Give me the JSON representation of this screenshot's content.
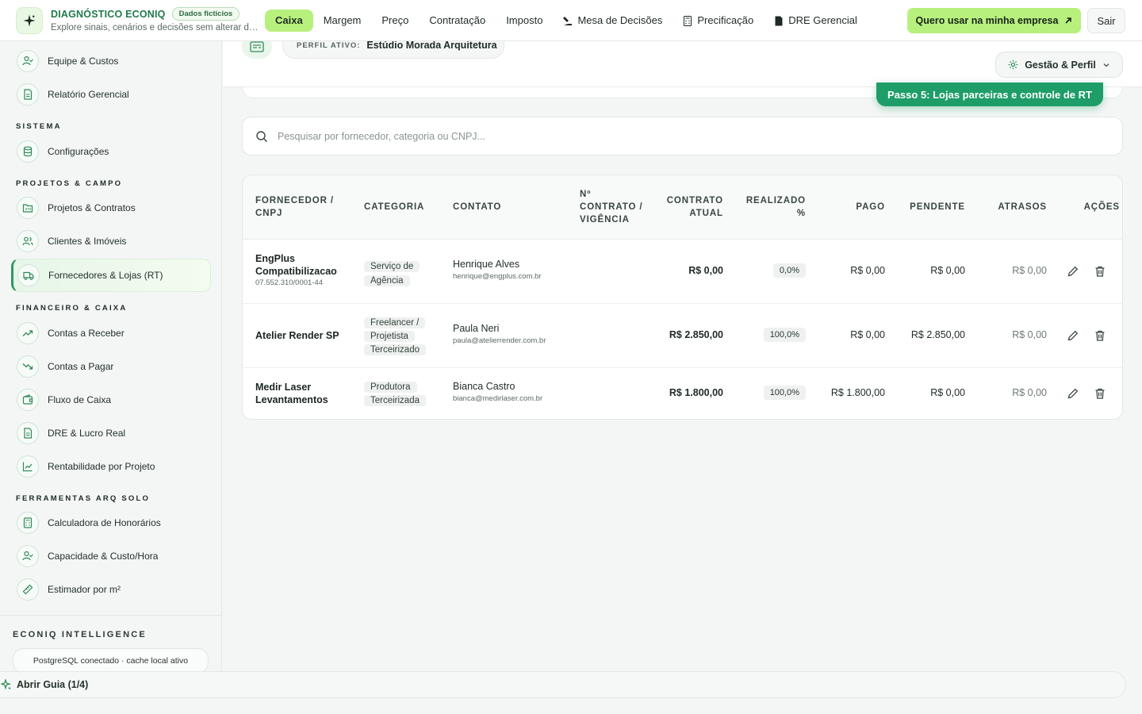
{
  "brand": {
    "title": "DIAGNÓSTICO ECONIQ",
    "badge": "Dados fictícios",
    "subtitle": "Explore sinais, cenários e decisões sem alterar da..."
  },
  "nav": {
    "items": [
      "Caixa",
      "Margem",
      "Preço",
      "Contratação",
      "Imposto"
    ],
    "mesa": "Mesa de Decisões",
    "precificacao": "Precificação",
    "dre": "DRE Gerencial",
    "active": "Caixa"
  },
  "cta": {
    "label": "Quero usar na minha empresa"
  },
  "exit": {
    "label": "Sair"
  },
  "sidebar": {
    "top_items": [
      "Equipe & Custos",
      "Relatório Gerencial"
    ],
    "sections": {
      "sistema": "SISTEMA",
      "projetos": "PROJETOS & CAMPO",
      "financeiro": "FINANCEIRO & CAIXA",
      "ferramentas": "FERRAMENTAS ARQ SOLO"
    },
    "sistema_items": [
      "Configurações"
    ],
    "projetos_items": [
      "Projetos & Contratos",
      "Clientes & Imóveis",
      "Fornecedores & Lojas (RT)"
    ],
    "financeiro_items": [
      "Contas a Receber",
      "Contas a Pagar",
      "Fluxo de Caixa",
      "DRE & Lucro Real",
      "Rentabilidade por Projeto"
    ],
    "ferramentas_items": [
      "Calculadora de Honorários",
      "Capacidade & Custo/Hora",
      "Estimador por m²"
    ],
    "intel_title": "ECONIQ INTELLIGENCE",
    "intel_status": "PostgreSQL conectado · cache local ativo"
  },
  "profile": {
    "label": "PERFIL ATIVO:",
    "name": "Estúdio Morada Arquitetura"
  },
  "gestao": {
    "label": "Gestão & Perfil"
  },
  "step": {
    "label": "Passo 5: Lojas parceiras e controle de RT"
  },
  "search": {
    "placeholder": "Pesquisar por fornecedor, categoria ou CNPJ..."
  },
  "table": {
    "headers": {
      "fornecedor": "FORNECEDOR / CNPJ",
      "categoria": "CATEGORIA",
      "contato": "CONTATO",
      "contrato_vig": "Nº CONTRATO / VIGÊNCIA",
      "contrato_atual": "CONTRATO ATUAL",
      "realizado": "REALIZADO %",
      "pago": "PAGO",
      "pendente": "PENDENTE",
      "atrasos": "ATRASOS",
      "acoes": "AÇÕES"
    },
    "rows": [
      {
        "name": "EngPlus Compatibilizacao",
        "doc": "07.552.310/0001-44",
        "category": "Serviço de Agência",
        "contact": "Henrique Alves",
        "email": "henrique@engplus.com.br",
        "contract": "",
        "current": "R$ 0,00",
        "realized": "0,0%",
        "paid": "R$ 0,00",
        "pending": "R$ 0,00",
        "late": "R$ 0,00"
      },
      {
        "name": "Atelier Render SP",
        "doc": "",
        "category": "Freelancer / Projetista Terceirizado",
        "contact": "Paula Neri",
        "email": "paula@atelierrender.com.br",
        "contract": "",
        "current": "R$ 2.850,00",
        "realized": "100,0%",
        "paid": "R$ 0,00",
        "pending": "R$ 2.850,00",
        "late": "R$ 0,00"
      },
      {
        "name": "Medir Laser Levantamentos",
        "doc": "",
        "category": "Produtora Terceirizada",
        "contact": "Bianca Castro",
        "email": "bianca@medirlaser.com.br",
        "contract": "",
        "current": "R$ 1.800,00",
        "realized": "100,0%",
        "paid": "R$ 1.800,00",
        "pending": "R$ 0,00",
        "late": "R$ 0,00"
      }
    ]
  },
  "guide": {
    "label": "Abrir Guia (1/4)"
  },
  "colors": {
    "accent": "#b8f07e",
    "brand_green": "#1f7a4c",
    "step_green": "#1f9d68"
  },
  "icons": {
    "logo": "sparkle-icon",
    "edit": "pencil-icon",
    "delete": "trash-icon",
    "search": "search-icon",
    "settings": "gear-icon"
  }
}
